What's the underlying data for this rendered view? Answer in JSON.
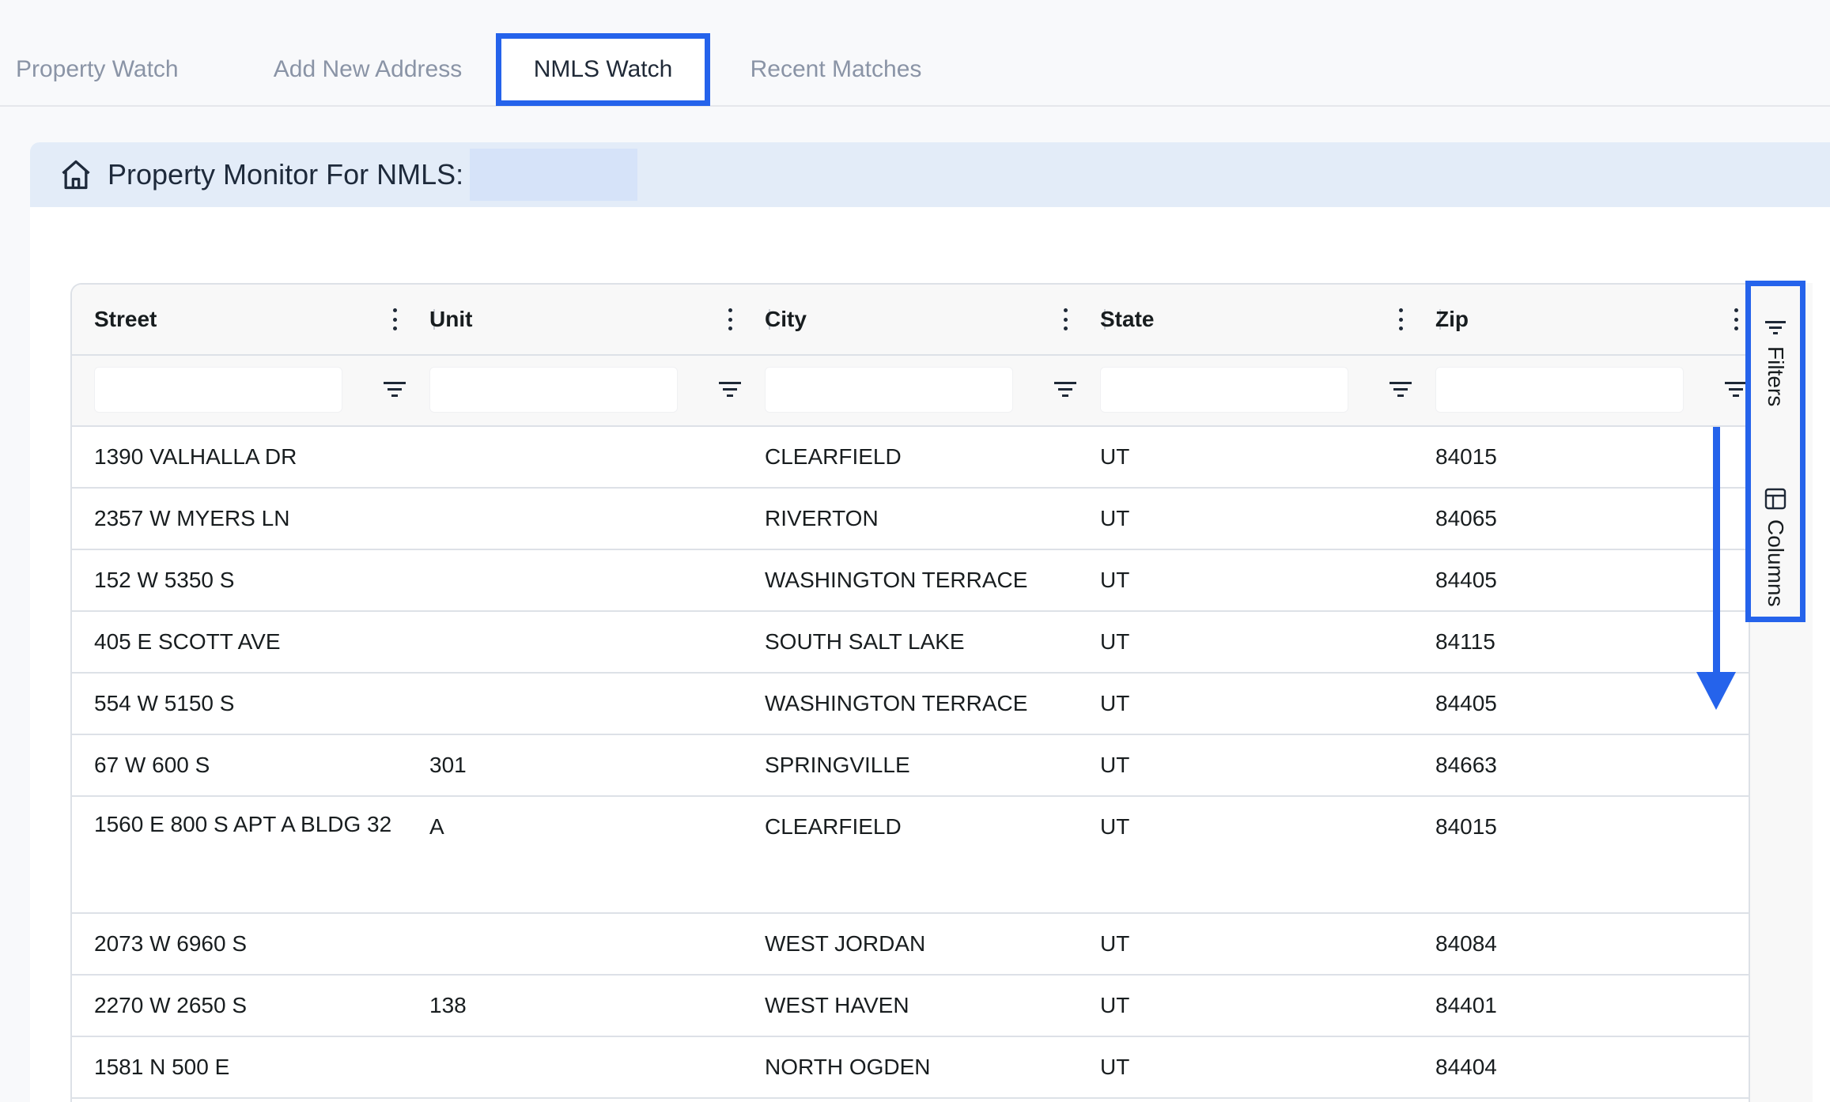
{
  "tabs": [
    {
      "label": "Property Watch"
    },
    {
      "label": "Add New Address"
    },
    {
      "label": "NMLS Watch",
      "active": true
    },
    {
      "label": "Recent Matches"
    }
  ],
  "card": {
    "title": "Property Monitor For NMLS:",
    "icon": "home-icon"
  },
  "grid": {
    "columns": [
      "Street",
      "Unit",
      "City",
      "State",
      "Zip"
    ],
    "rows": [
      {
        "street": "1390 VALHALLA DR",
        "unit": "",
        "city": "CLEARFIELD",
        "state": "UT",
        "zip": "84015"
      },
      {
        "street": "2357 W MYERS LN",
        "unit": "",
        "city": "RIVERTON",
        "state": "UT",
        "zip": "84065"
      },
      {
        "street": "152 W 5350 S",
        "unit": "",
        "city": "WASHINGTON TERRACE",
        "state": "UT",
        "zip": "84405"
      },
      {
        "street": "405 E SCOTT AVE",
        "unit": "",
        "city": "SOUTH SALT LAKE",
        "state": "UT",
        "zip": "84115"
      },
      {
        "street": "554 W 5150 S",
        "unit": "",
        "city": "WASHINGTON TERRACE",
        "state": "UT",
        "zip": "84405"
      },
      {
        "street": "67 W 600 S",
        "unit": "301",
        "city": "SPRINGVILLE",
        "state": "UT",
        "zip": "84663"
      },
      {
        "street": "1560 E 800 S APT A BLDG 32",
        "unit": "A",
        "city": "CLEARFIELD",
        "state": "UT",
        "zip": "84015"
      },
      {
        "street": "2073 W 6960 S",
        "unit": "",
        "city": "WEST JORDAN",
        "state": "UT",
        "zip": "84084"
      },
      {
        "street": "2270 W 2650 S",
        "unit": "138",
        "city": "WEST HAVEN",
        "state": "UT",
        "zip": "84401"
      },
      {
        "street": "1581 N 500 E",
        "unit": "",
        "city": "NORTH OGDEN",
        "state": "UT",
        "zip": "84404"
      }
    ]
  },
  "sidebar": {
    "filters_label": "Filters",
    "columns_label": "Columns"
  },
  "colors": {
    "highlight": "#2563eb",
    "header_band": "#e3ecf8"
  }
}
